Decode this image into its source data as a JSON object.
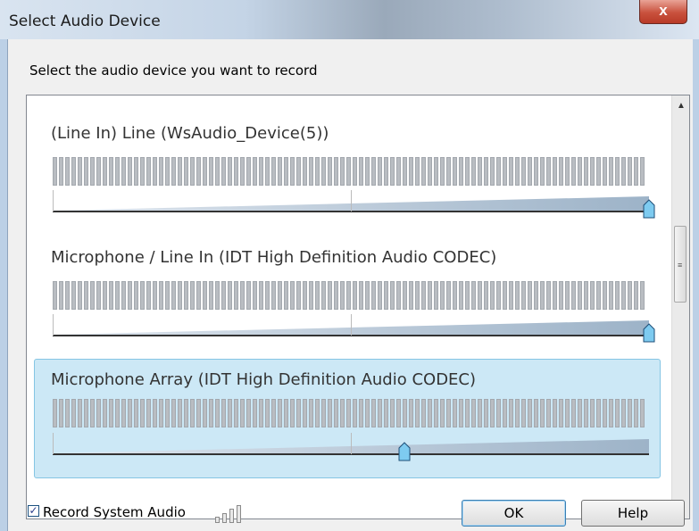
{
  "window": {
    "title": "Select Audio Device",
    "close_label": "x"
  },
  "instruction": "Select the audio device you want to record",
  "devices": [
    {
      "label": "(Line In) Line (WsAudio_Device(5))",
      "volume_fraction": 1.0,
      "selected": false
    },
    {
      "label": "Microphone / Line In (IDT High Definition Audio CODEC)",
      "volume_fraction": 1.0,
      "selected": false
    },
    {
      "label": "Microphone Array (IDT High Definition Audio CODEC)",
      "volume_fraction": 0.59,
      "selected": true
    }
  ],
  "record_system_audio": {
    "label": "Record System Audio",
    "checked": true
  },
  "buttons": {
    "ok": "OK",
    "help": "Help"
  },
  "colors": {
    "selection_bg": "#cce8f6",
    "thumb": "#7ecbf0"
  },
  "icons": {
    "scroll_up": "triangle-up-icon",
    "scroll_down": "triangle-down-icon",
    "grip": "scroll-grip-icon",
    "levels": "signal-level-icon"
  }
}
